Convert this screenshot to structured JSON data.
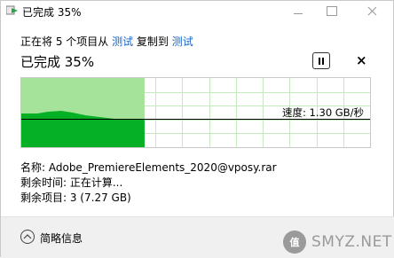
{
  "window": {
    "title": "已完成 35%",
    "controls": {
      "minimize": "minimize",
      "maximize": "maximize",
      "close": "close"
    }
  },
  "header": {
    "prefix": "正在将 5 个项目从 ",
    "source": "测试",
    "middle": " 复制到 ",
    "destination": "测试",
    "status": "已完成 35%"
  },
  "buttons": {
    "pause_icon": "pause-icon",
    "close_label": "×"
  },
  "chart": {
    "progress_percent": 35,
    "speed_label": "速度: 1.30 GB/秒",
    "colors": {
      "done_fill": "#a6e39a",
      "speed_fill": "#06b025",
      "grid": "#c7e9c0",
      "line": "#000000"
    }
  },
  "details": {
    "name": "名称: Adobe_PremiereElements_2020@vposy.rar",
    "time_remaining": "剩余时间: 正在计算...",
    "items_remaining": "剩余项目: 3 (7.27 GB)"
  },
  "footer": {
    "summary_label": "简略信息",
    "watermark_logo": "值",
    "watermark_text": "SMYZ.NET"
  }
}
